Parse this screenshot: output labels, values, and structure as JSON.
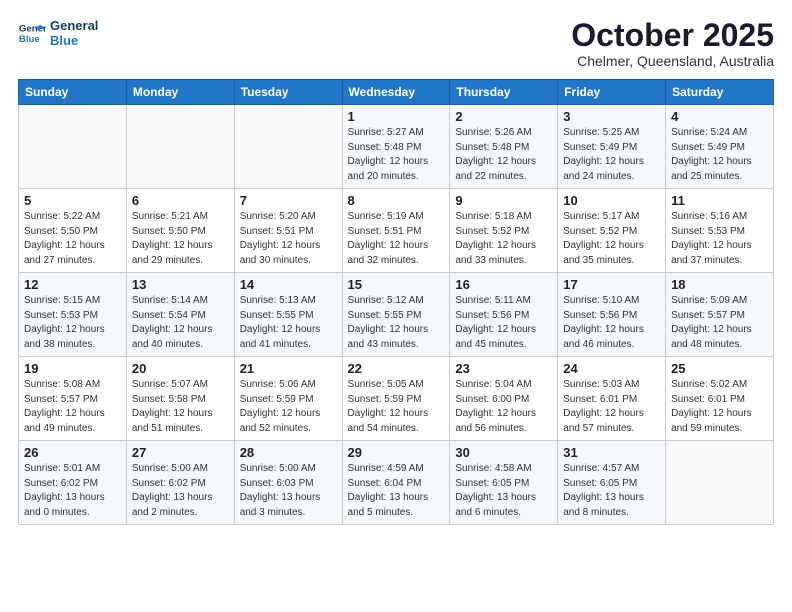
{
  "header": {
    "logo_line1": "General",
    "logo_line2": "Blue",
    "month_title": "October 2025",
    "location": "Chelmer, Queensland, Australia"
  },
  "weekdays": [
    "Sunday",
    "Monday",
    "Tuesday",
    "Wednesday",
    "Thursday",
    "Friday",
    "Saturday"
  ],
  "weeks": [
    [
      {
        "day": "",
        "info": ""
      },
      {
        "day": "",
        "info": ""
      },
      {
        "day": "",
        "info": ""
      },
      {
        "day": "1",
        "info": "Sunrise: 5:27 AM\nSunset: 5:48 PM\nDaylight: 12 hours\nand 20 minutes."
      },
      {
        "day": "2",
        "info": "Sunrise: 5:26 AM\nSunset: 5:48 PM\nDaylight: 12 hours\nand 22 minutes."
      },
      {
        "day": "3",
        "info": "Sunrise: 5:25 AM\nSunset: 5:49 PM\nDaylight: 12 hours\nand 24 minutes."
      },
      {
        "day": "4",
        "info": "Sunrise: 5:24 AM\nSunset: 5:49 PM\nDaylight: 12 hours\nand 25 minutes."
      }
    ],
    [
      {
        "day": "5",
        "info": "Sunrise: 5:22 AM\nSunset: 5:50 PM\nDaylight: 12 hours\nand 27 minutes."
      },
      {
        "day": "6",
        "info": "Sunrise: 5:21 AM\nSunset: 5:50 PM\nDaylight: 12 hours\nand 29 minutes."
      },
      {
        "day": "7",
        "info": "Sunrise: 5:20 AM\nSunset: 5:51 PM\nDaylight: 12 hours\nand 30 minutes."
      },
      {
        "day": "8",
        "info": "Sunrise: 5:19 AM\nSunset: 5:51 PM\nDaylight: 12 hours\nand 32 minutes."
      },
      {
        "day": "9",
        "info": "Sunrise: 5:18 AM\nSunset: 5:52 PM\nDaylight: 12 hours\nand 33 minutes."
      },
      {
        "day": "10",
        "info": "Sunrise: 5:17 AM\nSunset: 5:52 PM\nDaylight: 12 hours\nand 35 minutes."
      },
      {
        "day": "11",
        "info": "Sunrise: 5:16 AM\nSunset: 5:53 PM\nDaylight: 12 hours\nand 37 minutes."
      }
    ],
    [
      {
        "day": "12",
        "info": "Sunrise: 5:15 AM\nSunset: 5:53 PM\nDaylight: 12 hours\nand 38 minutes."
      },
      {
        "day": "13",
        "info": "Sunrise: 5:14 AM\nSunset: 5:54 PM\nDaylight: 12 hours\nand 40 minutes."
      },
      {
        "day": "14",
        "info": "Sunrise: 5:13 AM\nSunset: 5:55 PM\nDaylight: 12 hours\nand 41 minutes."
      },
      {
        "day": "15",
        "info": "Sunrise: 5:12 AM\nSunset: 5:55 PM\nDaylight: 12 hours\nand 43 minutes."
      },
      {
        "day": "16",
        "info": "Sunrise: 5:11 AM\nSunset: 5:56 PM\nDaylight: 12 hours\nand 45 minutes."
      },
      {
        "day": "17",
        "info": "Sunrise: 5:10 AM\nSunset: 5:56 PM\nDaylight: 12 hours\nand 46 minutes."
      },
      {
        "day": "18",
        "info": "Sunrise: 5:09 AM\nSunset: 5:57 PM\nDaylight: 12 hours\nand 48 minutes."
      }
    ],
    [
      {
        "day": "19",
        "info": "Sunrise: 5:08 AM\nSunset: 5:57 PM\nDaylight: 12 hours\nand 49 minutes."
      },
      {
        "day": "20",
        "info": "Sunrise: 5:07 AM\nSunset: 5:58 PM\nDaylight: 12 hours\nand 51 minutes."
      },
      {
        "day": "21",
        "info": "Sunrise: 5:06 AM\nSunset: 5:59 PM\nDaylight: 12 hours\nand 52 minutes."
      },
      {
        "day": "22",
        "info": "Sunrise: 5:05 AM\nSunset: 5:59 PM\nDaylight: 12 hours\nand 54 minutes."
      },
      {
        "day": "23",
        "info": "Sunrise: 5:04 AM\nSunset: 6:00 PM\nDaylight: 12 hours\nand 56 minutes."
      },
      {
        "day": "24",
        "info": "Sunrise: 5:03 AM\nSunset: 6:01 PM\nDaylight: 12 hours\nand 57 minutes."
      },
      {
        "day": "25",
        "info": "Sunrise: 5:02 AM\nSunset: 6:01 PM\nDaylight: 12 hours\nand 59 minutes."
      }
    ],
    [
      {
        "day": "26",
        "info": "Sunrise: 5:01 AM\nSunset: 6:02 PM\nDaylight: 13 hours\nand 0 minutes."
      },
      {
        "day": "27",
        "info": "Sunrise: 5:00 AM\nSunset: 6:02 PM\nDaylight: 13 hours\nand 2 minutes."
      },
      {
        "day": "28",
        "info": "Sunrise: 5:00 AM\nSunset: 6:03 PM\nDaylight: 13 hours\nand 3 minutes."
      },
      {
        "day": "29",
        "info": "Sunrise: 4:59 AM\nSunset: 6:04 PM\nDaylight: 13 hours\nand 5 minutes."
      },
      {
        "day": "30",
        "info": "Sunrise: 4:58 AM\nSunset: 6:05 PM\nDaylight: 13 hours\nand 6 minutes."
      },
      {
        "day": "31",
        "info": "Sunrise: 4:57 AM\nSunset: 6:05 PM\nDaylight: 13 hours\nand 8 minutes."
      },
      {
        "day": "",
        "info": ""
      }
    ]
  ]
}
